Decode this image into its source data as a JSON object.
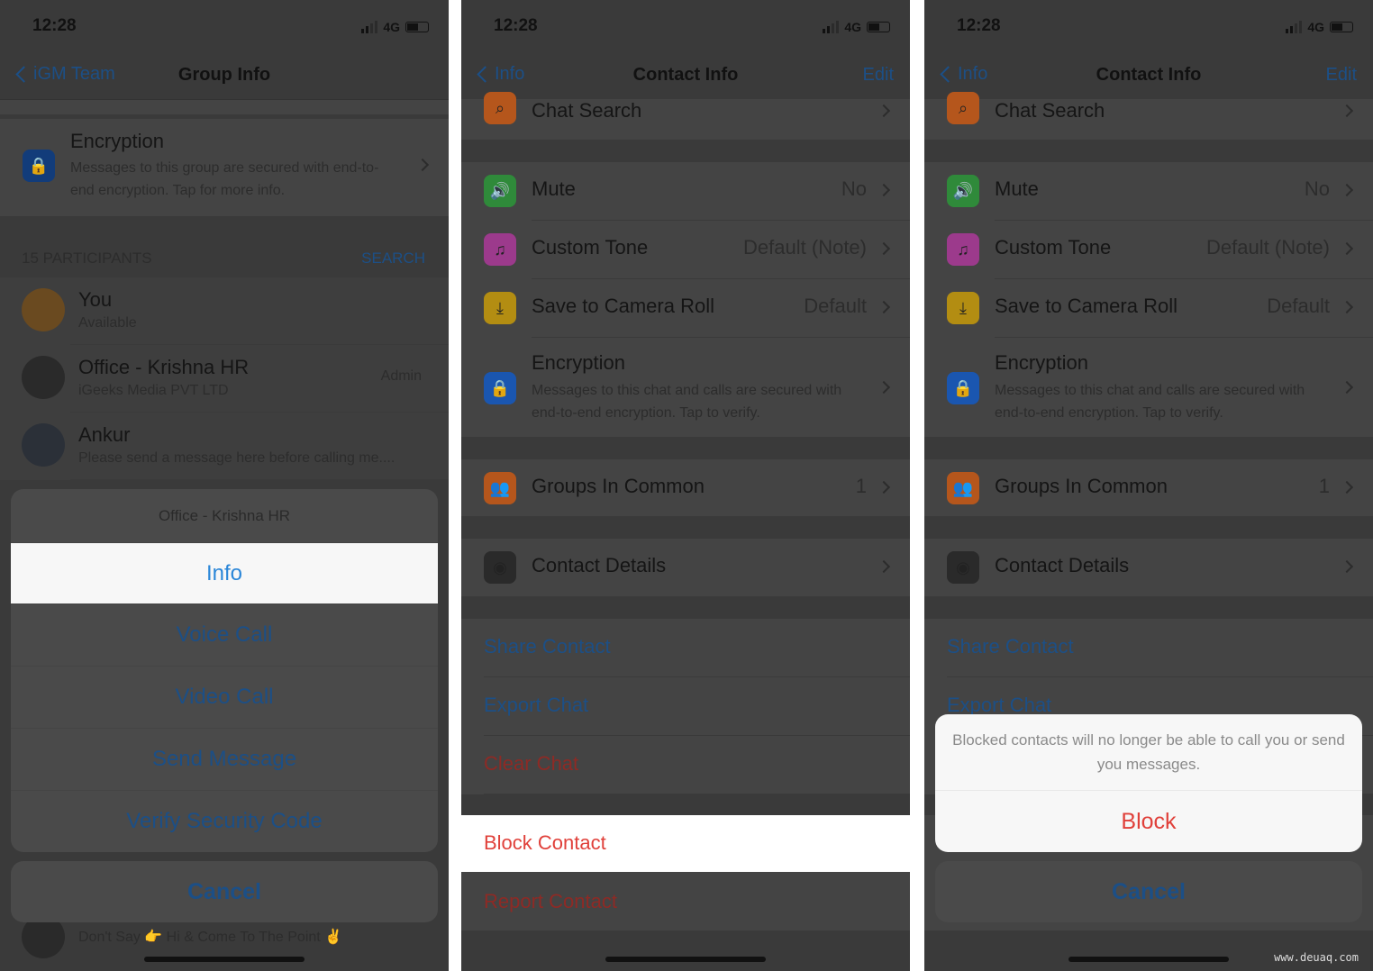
{
  "status": {
    "time": "12:28",
    "network": "4G"
  },
  "group": {
    "back_label": "iGM Team",
    "title": "Group Info",
    "encryption": {
      "title": "Encryption",
      "text": "Messages to this group are secured with end-to-end encryption. Tap for more info."
    },
    "participants_header": "15 PARTICIPANTS",
    "search_label": "SEARCH",
    "participants": [
      {
        "name": "You",
        "status": "Available",
        "badge": ""
      },
      {
        "name": "Office - Krishna HR",
        "status": "iGeeks Media PVT LTD",
        "badge": "Admin"
      },
      {
        "name": "Ankur",
        "status": "Please send a message here before calling me....",
        "badge": ""
      }
    ],
    "last_status": "Don't Say 👉 Hi & Come To The Point ✌",
    "sheet": {
      "title": "Office - Krishna HR",
      "options": [
        "Info",
        "Voice Call",
        "Video Call",
        "Send Message",
        "Verify Security Code"
      ],
      "cancel": "Cancel",
      "highlighted": "Info"
    }
  },
  "contact": {
    "back_label": "Info",
    "title": "Contact Info",
    "edit_label": "Edit",
    "rows": [
      {
        "label": "Chat Search",
        "value": "",
        "icon": "search-icon",
        "color": "#b5561c"
      },
      {
        "label": "Mute",
        "value": "No",
        "icon": "speaker-icon",
        "color": "#2f8a3a"
      },
      {
        "label": "Custom Tone",
        "value": "Default (Note)",
        "icon": "music-note-icon",
        "color": "#9c3a8c"
      },
      {
        "label": "Save to Camera Roll",
        "value": "Default",
        "icon": "download-icon",
        "color": "#b38d12"
      },
      {
        "label": "Encryption",
        "value": "",
        "icon": "lock-icon",
        "color": "#1a56b0",
        "sub": "Messages to this chat and calls are secured with end-to-end encryption. Tap to verify."
      },
      {
        "label": "Groups In Common",
        "value": "1",
        "icon": "group-icon",
        "color": "#b5561c"
      },
      {
        "label": "Contact Details",
        "value": "",
        "icon": "contact-icon",
        "color": "#2a2a2a"
      }
    ],
    "actions": [
      "Share Contact",
      "Export Chat",
      "Clear Chat"
    ],
    "block_label": "Block Contact",
    "report_label": "Report Contact",
    "alert": {
      "message": "Blocked contacts will no longer be able to call you or send you messages.",
      "confirm": "Block",
      "cancel": "Cancel"
    }
  },
  "colors": {
    "blue": "#2a86d8",
    "red": "#e0403a",
    "dim_blue": "#1c4f86",
    "dim_red": "#8e2a25"
  },
  "watermark": "www.deuaq.com"
}
